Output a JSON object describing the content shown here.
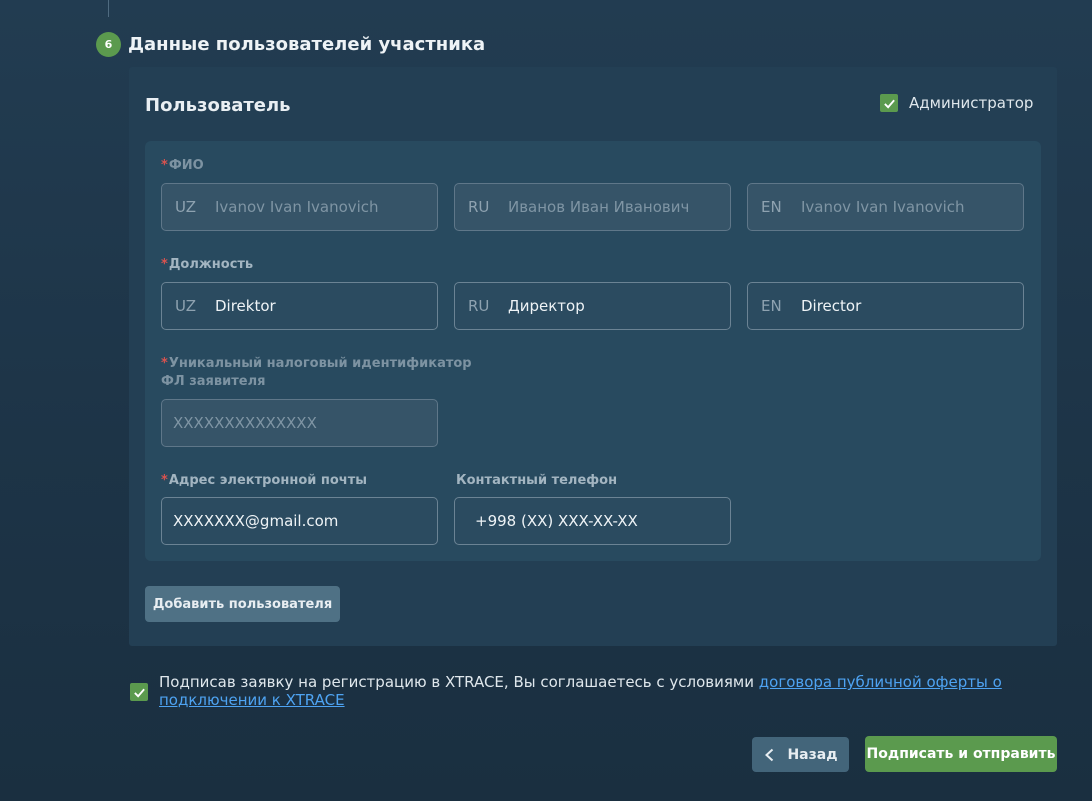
{
  "step": {
    "number": "6",
    "title": "Данные пользователей участника"
  },
  "user_card": {
    "title": "Пользователь",
    "admin_checkbox": {
      "label": "Администратор",
      "checked": true
    }
  },
  "fields": {
    "required_mark": "*",
    "fio": {
      "label": "ФИО",
      "inputs": [
        {
          "lang": "UZ",
          "placeholder": "Ivanov Ivan Ivanovich"
        },
        {
          "lang": "RU",
          "placeholder": "Иванов Иван Иванович"
        },
        {
          "lang": "EN",
          "placeholder": "Ivanov Ivan Ivanovich"
        }
      ]
    },
    "position": {
      "label": "Должность",
      "inputs": [
        {
          "lang": "UZ",
          "value": "Direktor"
        },
        {
          "lang": "RU",
          "value": "Директор"
        },
        {
          "lang": "EN",
          "value": "Director"
        }
      ]
    },
    "tin": {
      "label_line1": "Уникальный налоговый идентификатор",
      "label_line2": "ФЛ заявителя",
      "placeholder": "XXXXXXXXXXXXXX"
    },
    "email": {
      "label": "Адрес электронной почты",
      "value": "XXXXXXX@gmail.com"
    },
    "phone": {
      "label": "Контактный телефон",
      "value": "+998 (XX) XXX-XX-XX"
    }
  },
  "add_user_button": "Добавить пользователя",
  "agreement": {
    "checked": true,
    "text": "Подписав заявку на регистрацию в XTRACE, Вы соглашаетесь с условиями ",
    "link_text": "договора публичной оферты о подключении к XTRACE"
  },
  "buttons": {
    "back": "Назад",
    "submit": "Подписать и отправить"
  },
  "colors": {
    "accent_green": "#5b9a4e",
    "link_blue": "#4ea3f2",
    "required_red": "#d9534f"
  }
}
